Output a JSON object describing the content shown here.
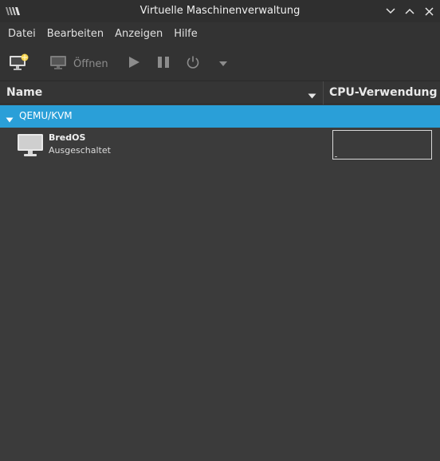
{
  "window": {
    "title": "Virtuelle Maschinenverwaltung",
    "app_icon": "vm-logo-icon",
    "buttons": [
      "minimize-icon",
      "maximize-icon",
      "close-icon"
    ]
  },
  "menu": {
    "items": [
      {
        "label": "Datei"
      },
      {
        "label": "Bearbeiten"
      },
      {
        "label": "Anzeigen"
      },
      {
        "label": "Hilfe"
      }
    ]
  },
  "toolbar": {
    "new_vm_icon": "new-vm-icon",
    "open_label": "Öffnen",
    "open_icon": "monitor-icon",
    "run_icon": "play-icon",
    "pause_icon": "pause-icon",
    "shutdown_icon": "power-icon",
    "menu_icon": "dropdown-arrow-icon"
  },
  "columns": {
    "name": "Name",
    "cpu": "CPU-Verwendung"
  },
  "groups": [
    {
      "label": "QEMU/KVM",
      "expanded": true,
      "vms": [
        {
          "name": "BredOS",
          "status": "Ausgeschaltet",
          "icon": "vm-monitor-icon"
        }
      ]
    }
  ],
  "colors": {
    "accent": "#2a9fd8",
    "background": "#3b3b3b",
    "titlebar": "#2f2f2f",
    "toolbar": "#333333"
  }
}
